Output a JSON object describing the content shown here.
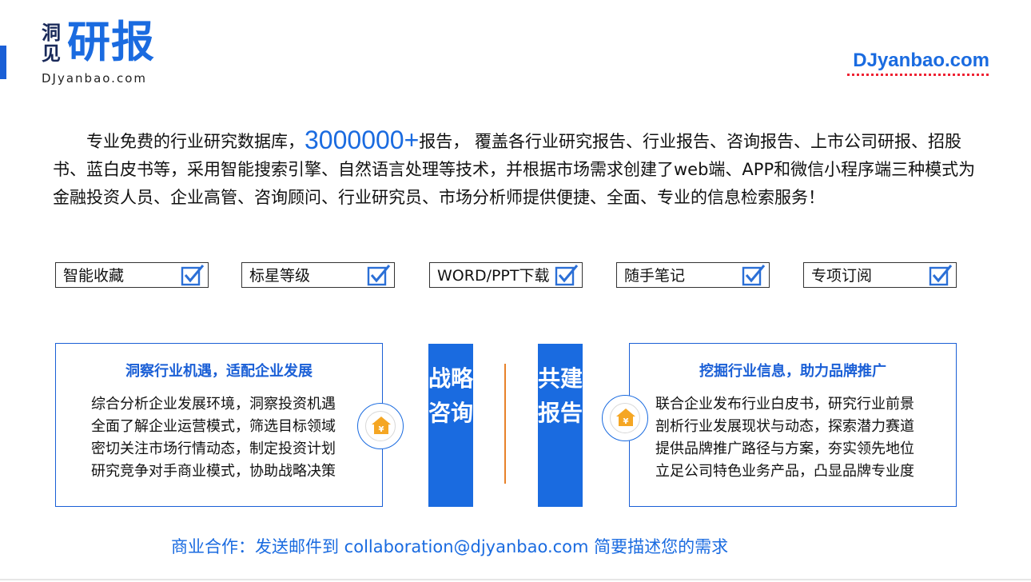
{
  "logo": {
    "small_text": "洞见",
    "big_text": "研报",
    "url": "DJyanbao.com"
  },
  "top_url": "DJyanbao.com",
  "intro": {
    "part1": "专业免费的行业研究数据库，",
    "number": "3000000+",
    "part2": "报告， 覆盖各行业研究报告、行业报告、咨询报告、上市公司研报、招股书、蓝白皮书等，采用智能搜索引擎、自然语言处理等技术，并根据市场需求创建了web端、APP和微信小程序端三种模式为金融投资人员、企业高管、咨询顾问、行业研究员、市场分析师提供便捷、全面、专业的信息检索服务！"
  },
  "features": [
    {
      "label": "智能收藏",
      "icon": "checkbox-checked-icon"
    },
    {
      "label": "标星等级",
      "icon": "checkbox-checked-icon"
    },
    {
      "label": "WORD/PPT下载",
      "icon": "checkbox-checked-icon"
    },
    {
      "label": "随手笔记",
      "icon": "checkbox-checked-icon"
    },
    {
      "label": "专项订阅",
      "icon": "checkbox-checked-icon"
    }
  ],
  "left_panel": {
    "title": "洞察行业机遇，适配企业发展",
    "lines": [
      "综合分析企业发展环境，洞察投资机遇",
      "全面了解企业运营模式，筛选目标领域",
      "密切关注市场行情动态，制定投资计划",
      "研究竞争对手商业模式，协助战略决策"
    ]
  },
  "right_panel": {
    "title": "挖掘行业信息，助力品牌推广",
    "lines": [
      "联合企业发布行业白皮书，研究行业前景",
      "剖析行业发展现状与动态，探索潜力赛道",
      "提供品牌推广路径与方案，夯实领先地位",
      "立足公司特色业务产品，凸显品牌专业度"
    ]
  },
  "vertical_left": "战略咨询",
  "vertical_right": "共建报告",
  "badge_icon": "house-yen-icon",
  "contact": "商业合作：发送邮件到 collaboration@djyanbao.com 简要描述您的需求",
  "colors": {
    "brand_blue": "#1a6be0",
    "accent_orange": "#f5a623",
    "divider_orange": "#e8822a"
  }
}
